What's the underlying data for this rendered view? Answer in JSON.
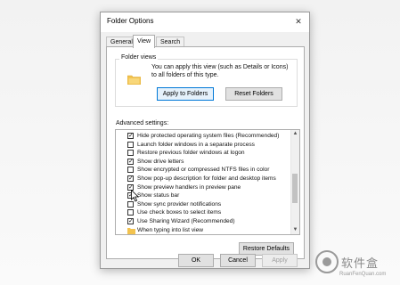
{
  "window": {
    "title": "Folder Options",
    "close_glyph": "✕"
  },
  "tabs": [
    {
      "label": "General"
    },
    {
      "label": "View",
      "active": true
    },
    {
      "label": "Search"
    }
  ],
  "folder_views": {
    "group_label": "Folder views",
    "description": "You can apply this view (such as Details or Icons) to all folders of this type.",
    "apply_button": "Apply to Folders",
    "reset_button": "Reset Folders",
    "icon": "folder-icon"
  },
  "advanced": {
    "label": "Advanced settings:",
    "items": [
      {
        "label": "Hide protected operating system files (Recommended)",
        "checked": true,
        "type": "checkbox"
      },
      {
        "label": "Launch folder windows in a separate process",
        "checked": false,
        "type": "checkbox"
      },
      {
        "label": "Restore previous folder windows at logon",
        "checked": false,
        "type": "checkbox"
      },
      {
        "label": "Show drive letters",
        "checked": true,
        "type": "checkbox"
      },
      {
        "label": "Show encrypted or compressed NTFS files in color",
        "checked": false,
        "type": "checkbox"
      },
      {
        "label": "Show pop-up description for folder and desktop items",
        "checked": true,
        "type": "checkbox"
      },
      {
        "label": "Show preview handlers in preview pane",
        "checked": true,
        "type": "checkbox"
      },
      {
        "label": "Show status bar",
        "checked": true,
        "type": "checkbox"
      },
      {
        "label": "Show sync provider notifications",
        "checked": false,
        "type": "checkbox"
      },
      {
        "label": "Use check boxes to select items",
        "checked": false,
        "type": "checkbox"
      },
      {
        "label": "Use Sharing Wizard (Recommended)",
        "checked": true,
        "type": "checkbox"
      },
      {
        "label": "When typing into list view",
        "checked": false,
        "type": "folder"
      }
    ],
    "restore_button": "Restore Defaults"
  },
  "footer": {
    "ok": "OK",
    "cancel": "Cancel",
    "apply": "Apply"
  },
  "watermark": {
    "cn": "软件盒",
    "en": "RuanFenQuan.com"
  },
  "colors": {
    "accent": "#0078d7",
    "folder": "#f3c34f"
  }
}
